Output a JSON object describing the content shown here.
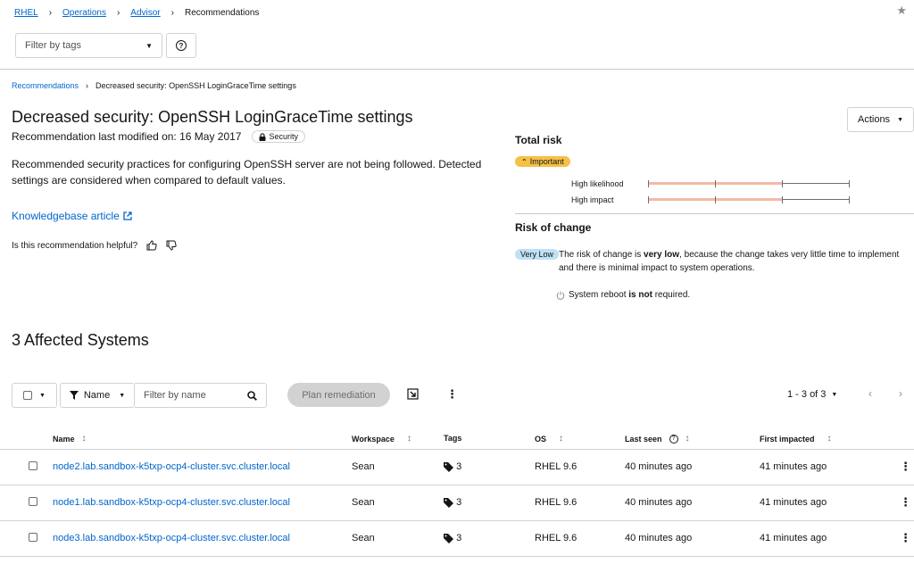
{
  "breadcrumb_top": {
    "items": [
      "RHEL",
      "Operations",
      "Advisor"
    ],
    "current": "Recommendations"
  },
  "filter": {
    "placeholder": "Filter by tags"
  },
  "breadcrumb": {
    "parent": "Recommendations",
    "current": "Decreased security: OpenSSH LoginGraceTime settings"
  },
  "recommendation": {
    "title": "Decreased security: OpenSSH LoginGraceTime settings",
    "modified": "Recommendation last modified on: 16 May 2017",
    "category": "Security",
    "description": "Recommended security practices for configuring OpenSSH server are not being followed. Detected settings are considered when compared to default values.",
    "kb_link": "Knowledgebase article",
    "helpful_question": "Is this recommendation helpful?",
    "actions_label": "Actions"
  },
  "total_risk": {
    "heading": "Total risk",
    "level": "Important",
    "likelihood_label": "High likelihood",
    "impact_label": "High impact",
    "likelihood_fraction": 0.67,
    "impact_fraction": 0.67
  },
  "risk_of_change": {
    "heading": "Risk of change",
    "level": "Very Low",
    "text_pre": "The risk of change is ",
    "text_bold": "very low",
    "text_post": ", because the change takes very little time to implement and there is minimal impact to system operations.",
    "reboot_pre": "System reboot ",
    "reboot_bold": "is not",
    "reboot_post": " required."
  },
  "affected": {
    "heading": "3 Affected Systems",
    "filter_field": "Name",
    "search_placeholder": "Filter by name",
    "plan_button": "Plan remediation",
    "pagination": "1 - 3 of 3",
    "columns": [
      "Name",
      "Workspace",
      "Tags",
      "OS",
      "Last seen",
      "First impacted"
    ],
    "rows": [
      {
        "name": "node2.lab.sandbox-k5txp-ocp4-cluster.svc.cluster.local",
        "workspace": "Sean",
        "tags": "3",
        "os": "RHEL 9.6",
        "last_seen": "40 minutes ago",
        "first_impacted": "41 minutes ago"
      },
      {
        "name": "node1.lab.sandbox-k5txp-ocp4-cluster.svc.cluster.local",
        "workspace": "Sean",
        "tags": "3",
        "os": "RHEL 9.6",
        "last_seen": "40 minutes ago",
        "first_impacted": "41 minutes ago"
      },
      {
        "name": "node3.lab.sandbox-k5txp-ocp4-cluster.svc.cluster.local",
        "workspace": "Sean",
        "tags": "3",
        "os": "RHEL 9.6",
        "last_seen": "40 minutes ago",
        "first_impacted": "41 minutes ago"
      }
    ]
  },
  "colors": {
    "link": "#0066cc",
    "important": "#f4c145",
    "very_low": "#bee1f4",
    "risk_fill": "#f4b9a4"
  }
}
